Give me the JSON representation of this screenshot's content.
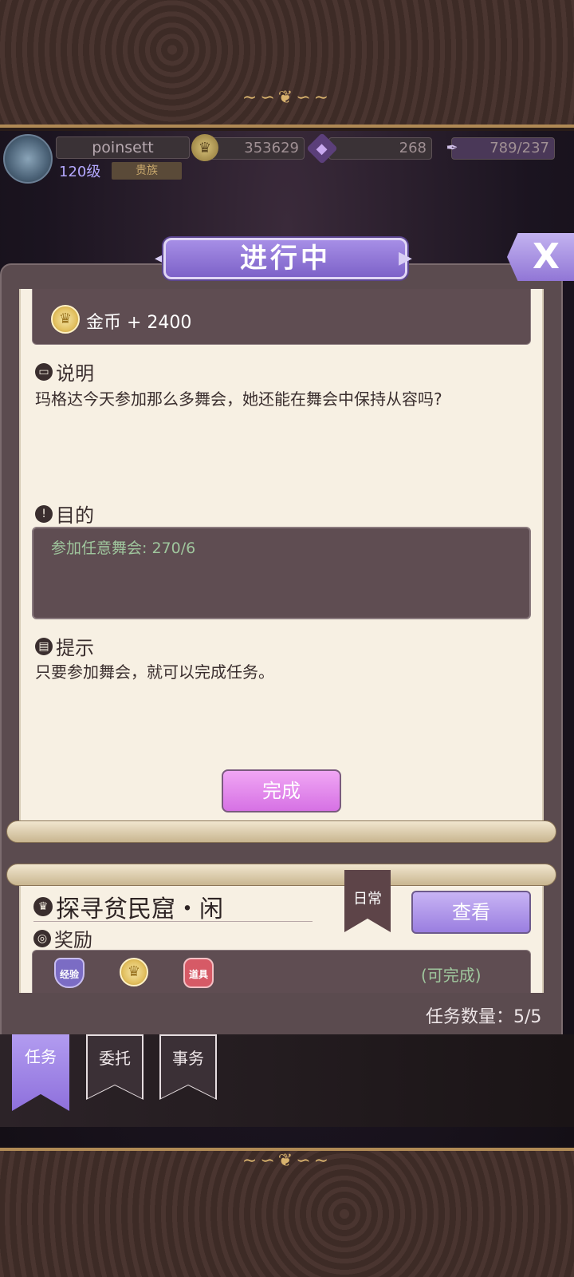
{
  "player": {
    "name": "poinsett",
    "level": "120级",
    "title_badge": "贵族"
  },
  "resources": {
    "gold": "353629",
    "diamond": "268",
    "stamina": "789/237"
  },
  "header": {
    "title": "进行中",
    "close_label": "X"
  },
  "current_quest": {
    "reward_text": "金币 + 2400",
    "description_label": "说明",
    "description": "玛格达今天参加那么多舞会，她还能在舞会中保持从容吗?",
    "goal_label": "目的",
    "goal": "参加任意舞会: 270/6",
    "hint_label": "提示",
    "hint": "只要参加舞会，就可以完成任务。",
    "complete_button": "完成"
  },
  "next_quest": {
    "title": "探寻贫民窟・闲",
    "tag": "日常",
    "view_button": "查看",
    "reward_label": "奖励",
    "reward_badges": [
      "经验",
      "道具"
    ],
    "status": "(可完成)"
  },
  "task_count": "任务数量：5/5",
  "tabs": [
    {
      "label": "任务",
      "active": true
    },
    {
      "label": "委托",
      "active": false
    },
    {
      "label": "事务",
      "active": false
    }
  ],
  "colors": {
    "accent_purple": "#9176d6",
    "complete_pink": "#e08aee",
    "paper": "#f7f0e3",
    "goal_green": "#9fc69d"
  }
}
